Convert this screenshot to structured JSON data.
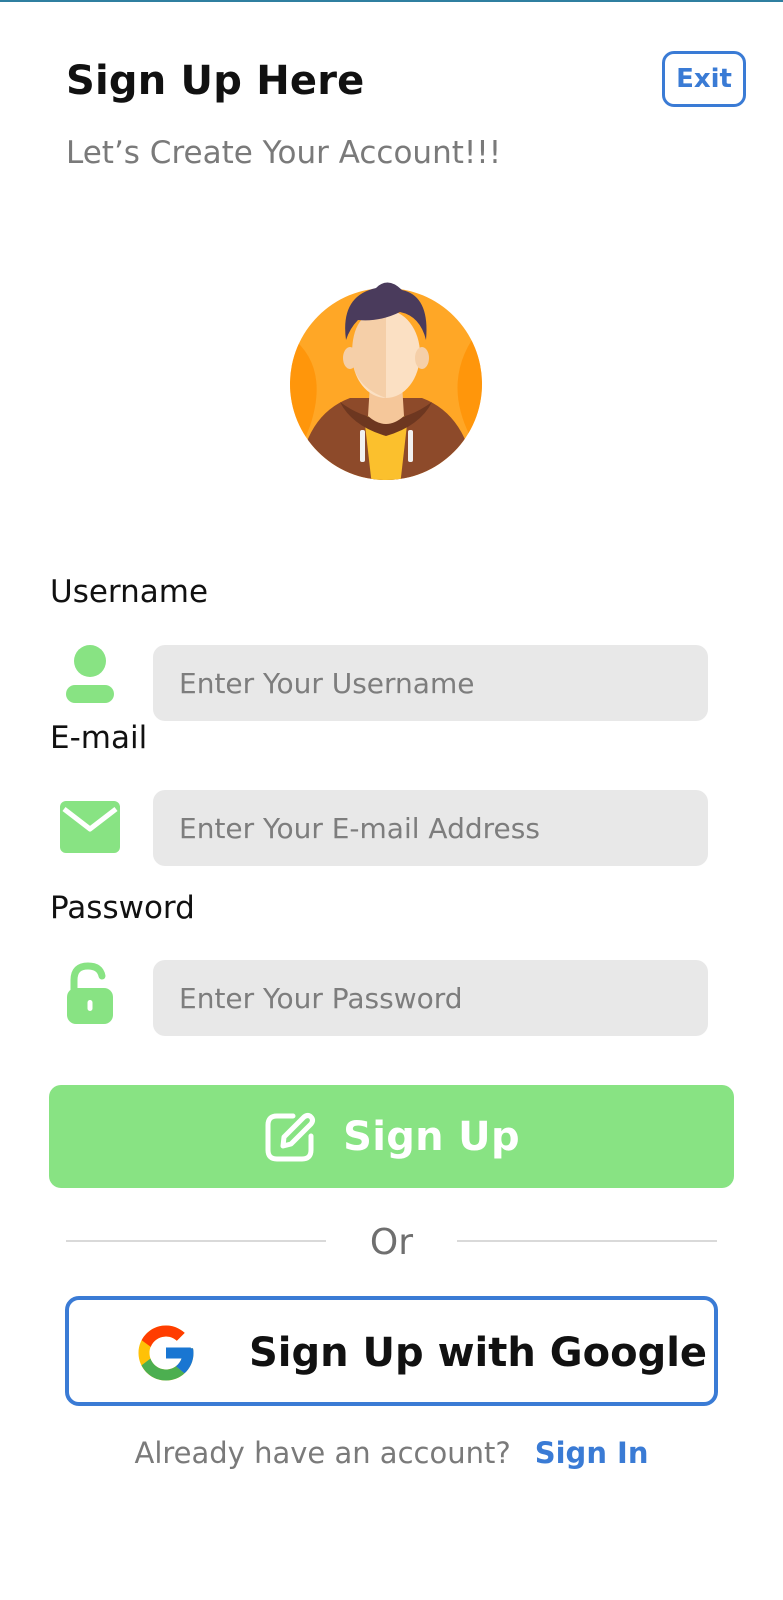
{
  "header": {
    "title": "Sign Up Here",
    "subtitle": "Let’s Create Your Account!!!",
    "exit_label": "Exit"
  },
  "avatar": {
    "icon": "user-avatar-illustration"
  },
  "form": {
    "username": {
      "label": "Username",
      "placeholder": "Enter Your Username",
      "value": "",
      "icon": "person-icon"
    },
    "email": {
      "label": "E-mail",
      "placeholder": "Enter Your E-mail Address",
      "value": "",
      "icon": "envelope-icon"
    },
    "password": {
      "label": "Password",
      "placeholder": "Enter Your Password",
      "value": "",
      "icon": "unlocked-padlock-icon"
    }
  },
  "actions": {
    "signup_label": "Sign Up",
    "signup_icon": "edit-icon",
    "or_text": "Or",
    "google_label": "Sign Up with Google",
    "google_icon": "google-g-icon"
  },
  "footer": {
    "prompt": "Already have an account?",
    "signin_label": "Sign In"
  },
  "colors": {
    "accent_blue": "#3a7bd5",
    "accent_green": "#88e383",
    "field_bg": "#e8e8e8"
  }
}
